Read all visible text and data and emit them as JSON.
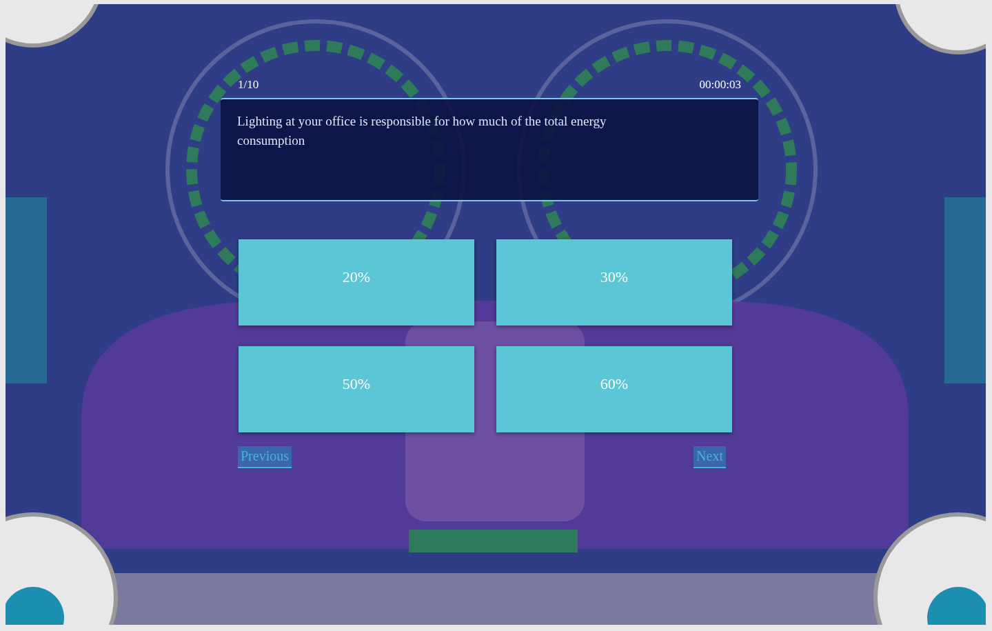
{
  "quiz": {
    "progress": "1/10",
    "timer": "00:00:03",
    "question": "Lighting at your office is responsible for how much of the total energy consumption",
    "answers": [
      {
        "label": "20%",
        "selected": false
      },
      {
        "label": "30%",
        "selected": false
      },
      {
        "label": "50%",
        "selected": false
      },
      {
        "label": "60%",
        "selected": false
      }
    ],
    "previous": {
      "label": "Previous",
      "disabled": true
    },
    "next": {
      "label": "Next",
      "disabled": true
    }
  }
}
